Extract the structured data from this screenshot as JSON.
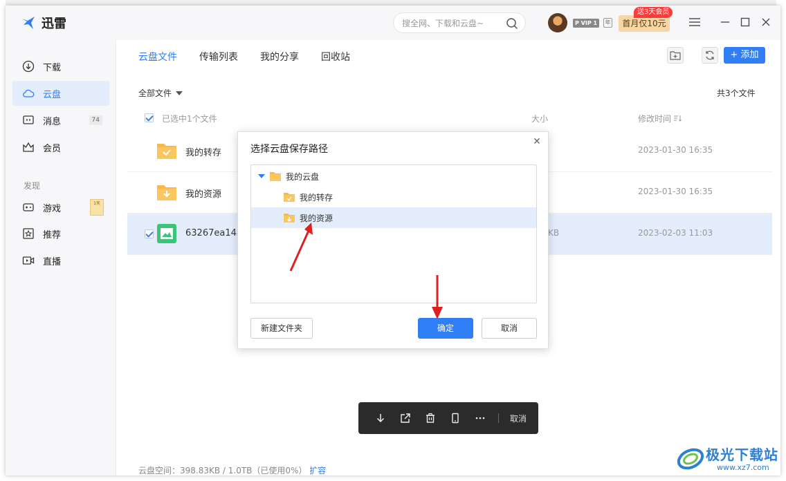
{
  "app": {
    "title": "迅雷"
  },
  "search": {
    "placeholder": "搜全网、下载和云盘~"
  },
  "account": {
    "vip_label": "P VIP 1",
    "year_label": "年",
    "promo_tag": "送3天会员",
    "promo_button": "首月仅10元"
  },
  "sidebar": {
    "items": [
      {
        "label": "下载",
        "icon": "download-icon"
      },
      {
        "label": "云盘",
        "icon": "cloud-icon",
        "active": true
      },
      {
        "label": "消息",
        "icon": "message-icon",
        "count": "74"
      },
      {
        "label": "会员",
        "icon": "crown-icon"
      }
    ],
    "section_label": "发现",
    "discover": [
      {
        "label": "游戏",
        "icon": "gamepad-icon",
        "badge": "1天"
      },
      {
        "label": "推荐",
        "icon": "star-icon"
      },
      {
        "label": "直播",
        "icon": "live-icon"
      }
    ]
  },
  "main": {
    "tabs": [
      {
        "label": "云盘文件",
        "active": true
      },
      {
        "label": "传输列表"
      },
      {
        "label": "我的分享"
      },
      {
        "label": "回收站"
      }
    ],
    "add_button": "+ 添加",
    "filter_label": "全部文件",
    "total_label": "共3个文件",
    "selection_label": "已选中1个文件",
    "col_size": "大小",
    "col_modified": "修改时间",
    "files": [
      {
        "name": "我的转存",
        "size": "",
        "date": "2023-01-30 16:35",
        "selected": false
      },
      {
        "name": "我的资源",
        "size": "",
        "date": "2023-01-30 16:35",
        "selected": false
      },
      {
        "name": "63267ea14a",
        "size": "KB",
        "date": "2023-02-03 11:03",
        "selected": true
      }
    ],
    "storage_info": "云盘空间：398.83KB / 1.0TB（已使用0%）",
    "storage_link": "扩容"
  },
  "float_bar": {
    "cancel_label": "取消"
  },
  "dialog": {
    "title": "选择云盘保存路径",
    "tree": [
      {
        "label": "我的云盘"
      },
      {
        "label": "我的转存"
      },
      {
        "label": "我的资源",
        "selected": true
      }
    ],
    "new_folder_button": "新建文件夹",
    "confirm_button": "确定",
    "cancel_button": "取消"
  },
  "watermark": {
    "text": "极光下载站",
    "url": "www.xz7.com"
  },
  "colors": {
    "accent": "#2f7ef5",
    "folder": "#f8b84e",
    "arrow": "#e02020"
  }
}
